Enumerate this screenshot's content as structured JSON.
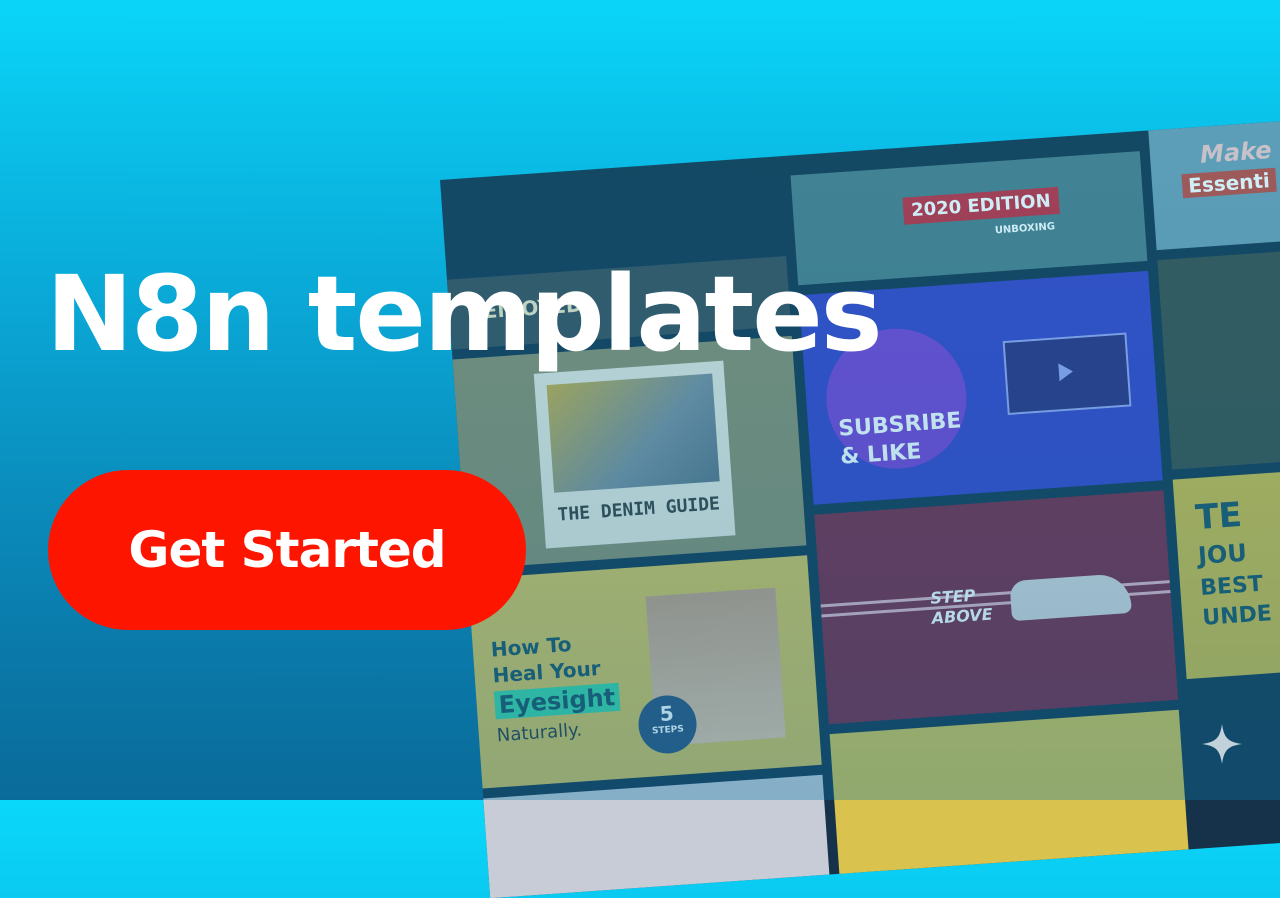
{
  "hero": {
    "title": "N8n templates",
    "cta_label": "Get Started"
  },
  "collage": {
    "tile_enjoyed": {
      "text": "I ENJOYED!"
    },
    "tile_denim": {
      "text": "THE DENIM GUIDE"
    },
    "tile_edition": {
      "badge": "2020 EDITION",
      "tag": "UNBOXING"
    },
    "tile_subscribe": {
      "line1": "SUBSRIBE",
      "line2": "& LIKE"
    },
    "tile_eyesight": {
      "line1": "How To",
      "line2": "Heal Your",
      "line3": "Eyesight",
      "line4": "Naturally.",
      "badge_num": "5",
      "badge_text": "STEPS"
    },
    "tile_step": {
      "line1": "STEP",
      "line2": "ABOVE"
    },
    "tile_make": {
      "line1": "Make",
      "line2": "Essenti"
    },
    "tile_journal": {
      "line1": "TE",
      "line2": "JOU",
      "line3": "BEST",
      "line4": "UNDE"
    }
  },
  "colors": {
    "accent": "#fe1500",
    "bg_top": "#0ad8fb",
    "bg_bottom": "#0a6490"
  },
  "icons": {
    "sparkle": "sparkle-icon"
  }
}
